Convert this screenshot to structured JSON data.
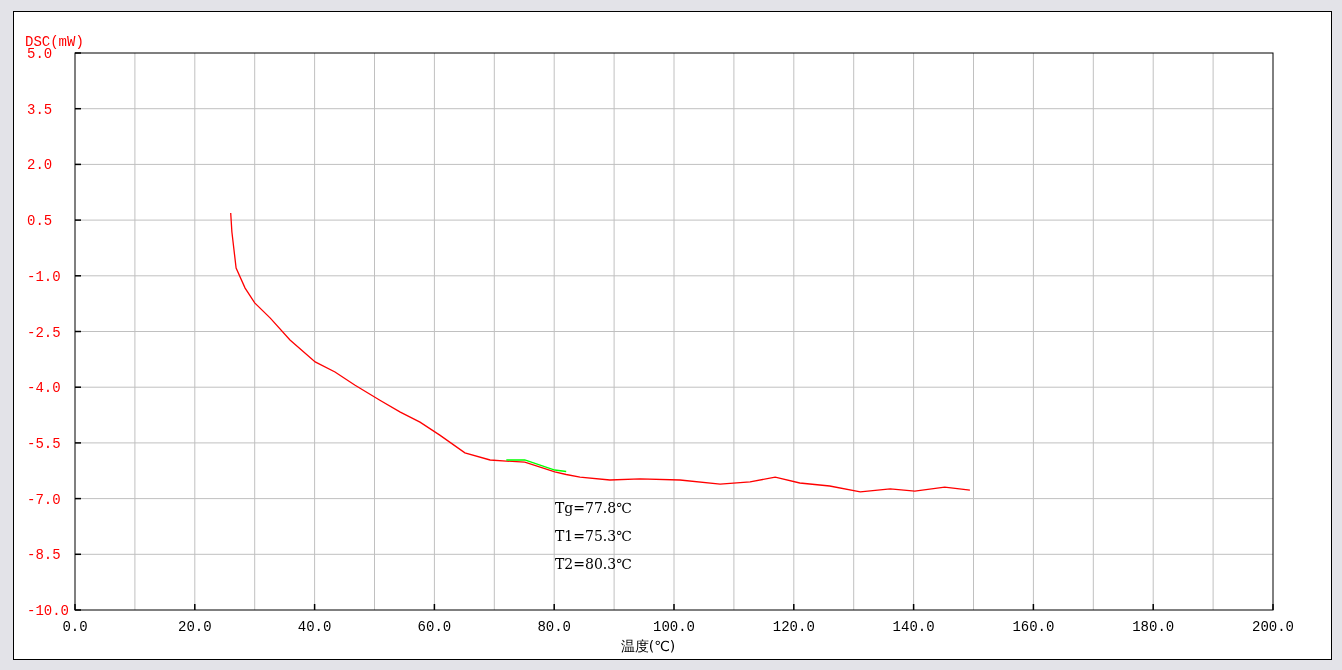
{
  "chart_data": {
    "type": "line",
    "xlabel": "温度(℃)",
    "ylabel": "DSC(mW)",
    "x": [
      26.0,
      26.2,
      26.9,
      28.4,
      30.0,
      32.6,
      35.9,
      40.1,
      43.4,
      46.7,
      50.9,
      54.3,
      57.6,
      60.9,
      65.1,
      69.3,
      72.0,
      75.1,
      80.1,
      82.0,
      84.3,
      89.3,
      94.3,
      101.0,
      107.7,
      112.7,
      116.9,
      121.0,
      126.0,
      131.1,
      136.1,
      140.2,
      145.2,
      149.4
    ],
    "series": [
      {
        "color": "#ff0000",
        "values": [
          0.69,
          0.18,
          -0.79,
          -1.33,
          -1.73,
          -2.14,
          -2.73,
          -3.32,
          -3.59,
          -3.94,
          -4.35,
          -4.67,
          -4.94,
          -5.29,
          -5.77,
          -5.96,
          -5.99,
          -6.02,
          -6.28,
          -6.35,
          -6.42,
          -6.5,
          -6.47,
          -6.5,
          -6.61,
          -6.55,
          -6.42,
          -6.58,
          -6.66,
          -6.82,
          -6.74,
          -6.8,
          -6.69,
          -6.77
        ]
      },
      {
        "color": "#00ff00",
        "values": [
          null,
          null,
          null,
          null,
          null,
          null,
          null,
          null,
          null,
          null,
          null,
          null,
          null,
          null,
          null,
          null,
          -5.96,
          -5.96,
          -6.23,
          -6.27,
          null,
          null,
          null,
          null,
          null,
          null,
          null,
          null,
          null,
          null,
          null,
          null,
          null,
          null
        ]
      }
    ],
    "xlim": [
      0,
      200
    ],
    "ylim": [
      -10,
      5
    ],
    "xticks": [
      {
        "value": 0,
        "label": "0.0"
      },
      {
        "value": 20,
        "label": "20.0"
      },
      {
        "value": 40,
        "label": "40.0"
      },
      {
        "value": 60,
        "label": "60.0"
      },
      {
        "value": 80,
        "label": "80.0"
      },
      {
        "value": 100,
        "label": "100.0"
      },
      {
        "value": 120,
        "label": "120.0"
      },
      {
        "value": 140,
        "label": "140.0"
      },
      {
        "value": 160,
        "label": "160.0"
      },
      {
        "value": 180,
        "label": "180.0"
      },
      {
        "value": 200,
        "label": "200.0"
      }
    ],
    "yticks": [
      {
        "value": 5,
        "label": "5.0"
      },
      {
        "value": 3.5,
        "label": "3.5"
      },
      {
        "value": 2,
        "label": "2.0"
      },
      {
        "value": 0.5,
        "label": "0.5"
      },
      {
        "value": -1,
        "label": "-1.0"
      },
      {
        "value": -2.5,
        "label": "-2.5"
      },
      {
        "value": -4,
        "label": "-4.0"
      },
      {
        "value": -5.5,
        "label": "-5.5"
      },
      {
        "value": -7,
        "label": "-7.0"
      },
      {
        "value": -8.5,
        "label": "-8.5"
      },
      {
        "value": -10,
        "label": "-10.0"
      }
    ],
    "grid": true,
    "annotations": [
      "Tg=77.8℃",
      "T1=75.3℃",
      "T2=80.3℃"
    ]
  }
}
